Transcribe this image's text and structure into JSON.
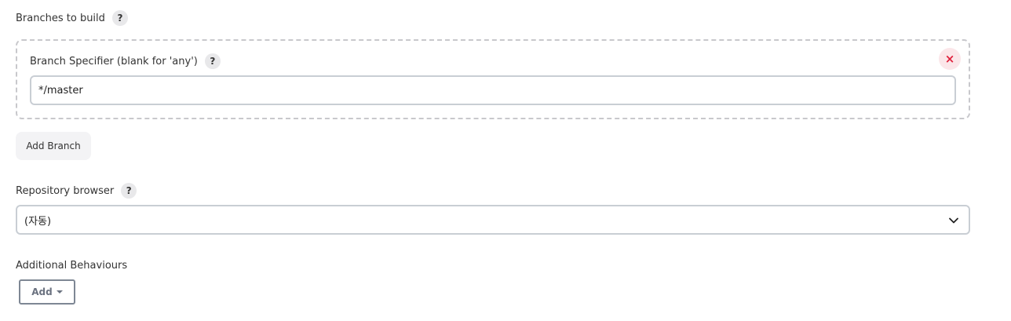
{
  "branches_section": {
    "label": "Branches to build",
    "help": "?"
  },
  "branch_spec": {
    "label": "Branch Specifier (blank for 'any')",
    "help": "?",
    "value": "*/master",
    "remove_icon": "×"
  },
  "add_branch_button": "Add Branch",
  "repository_browser": {
    "label": "Repository browser",
    "help": "?",
    "selected": "(자동)"
  },
  "additional_behaviours": {
    "label": "Additional Behaviours",
    "add_button": "Add"
  },
  "colors": {
    "remove_accent": "#e0213d",
    "border": "#c9ced4"
  }
}
